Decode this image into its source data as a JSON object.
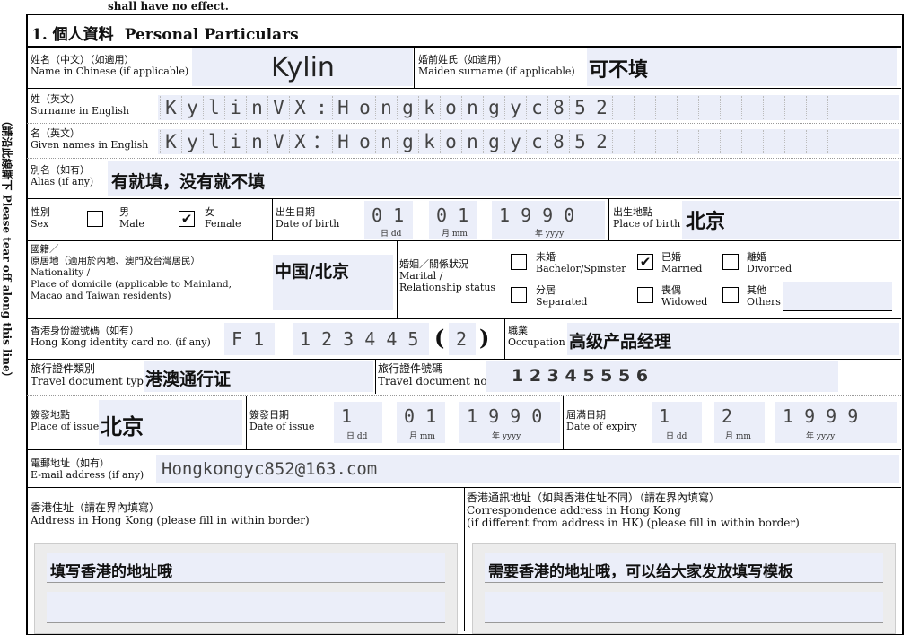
{
  "top_note": "shall have no effect.",
  "side_label": "（請沿此線撕下 Please tear off along this line）",
  "section": {
    "number": "1.",
    "title_zh": "個人資料",
    "title_en": "Personal Particulars"
  },
  "name_zh": {
    "label_zh": "姓名（中文）（如適用）",
    "label_en": "Name in Chinese (if applicable)",
    "value": "Kylin"
  },
  "maiden": {
    "label_zh": "婚前姓氏（如適用）",
    "label_en": "Maiden surname (if applicable)",
    "value": "可不填"
  },
  "surname": {
    "label_zh": "姓（英文）",
    "label_en": "Surname in English",
    "chars": [
      "K",
      "y",
      "l",
      "i",
      "n",
      "V",
      "X",
      ":",
      "H",
      "o",
      "n",
      "g",
      "k",
      "o",
      "n",
      "g",
      "y",
      "c",
      "8",
      "5",
      "2",
      "",
      "",
      "",
      "",
      "",
      "",
      "",
      "",
      "",
      "",
      ""
    ]
  },
  "given": {
    "label_zh": "名（英文）",
    "label_en": "Given names in English",
    "chars": [
      "K",
      "y",
      "l",
      "i",
      "n",
      "V",
      "X",
      "：",
      "H",
      "o",
      "n",
      "g",
      "k",
      "o",
      "n",
      "g",
      "y",
      "c",
      "8",
      "5",
      "2",
      "",
      "",
      "",
      "",
      "",
      "",
      "",
      "",
      "",
      "",
      ""
    ]
  },
  "alias": {
    "label_zh": "別名（如有）",
    "label_en": "Alias (if any)",
    "value": "有就填，没有就不填"
  },
  "sex": {
    "label_zh": "性別",
    "label_en": "Sex",
    "male_zh": "男",
    "male_en": "Male",
    "female_zh": "女",
    "female_en": "Female",
    "male_checked": "",
    "female_checked": "✔"
  },
  "dob": {
    "label_zh": "出生日期",
    "label_en": "Date of birth",
    "dd": "0 1",
    "mm": "0 1",
    "yyyy": "1 9 9 0",
    "dd_hint": "日 dd",
    "mm_hint": "月 mm",
    "yyyy_hint": "年 yyyy"
  },
  "pob": {
    "label_zh": "出生地點",
    "label_en": "Place of birth",
    "value": "北京"
  },
  "nationality": {
    "l1": "國籍／",
    "l2": "原居地（適用於內地、澳門及台灣居民）",
    "l3": "Nationality /",
    "l4": "Place of domicile (applicable to Mainland,",
    "l5": "Macao and Taiwan residents)",
    "value": "中国/北京"
  },
  "marital": {
    "label_zh": "婚姻／關係狀況",
    "label_en1": "Marital /",
    "label_en2": "Relationship status",
    "bachelor_zh": "未婚",
    "bachelor_en": "Bachelor/Spinster",
    "married_zh": "已婚",
    "married_en": "Married",
    "married_checked": "✔",
    "divorced_zh": "離婚",
    "divorced_en": "Divorced",
    "separated_zh": "分居",
    "separated_en": "Separated",
    "widowed_zh": "喪偶",
    "widowed_en": "Widowed",
    "others_zh": "其他",
    "others_en": "Others"
  },
  "hkid": {
    "label_zh": "香港身份證號碼（如有）",
    "label_en": "Hong Kong identity card no. (if any)",
    "prefix": "F 1",
    "digits": "1 2 3 4 4 5",
    "open": "(",
    "check": "2",
    "close": ")"
  },
  "occupation": {
    "label_zh": "職業",
    "label_en": "Occupation",
    "value": "高级产品经理"
  },
  "travel_type": {
    "label_zh": "旅行證件類別",
    "label_en": "Travel document type",
    "value": "港澳通行证"
  },
  "travel_no": {
    "label_zh": "旅行證件號碼",
    "label_en": "Travel document no.",
    "value": "1 2 3 4 5 5 5 6"
  },
  "issue_place": {
    "label_zh": "簽發地點",
    "label_en": "Place of issue",
    "value": "北京"
  },
  "issue_date": {
    "label_zh": "簽發日期",
    "label_en": "Date of issue",
    "dd": "1",
    "mm": "0 1",
    "yyyy": "1 9 9 0",
    "dd_hint": "日 dd",
    "mm_hint": "月 mm",
    "yyyy_hint": "年 yyyy"
  },
  "expiry": {
    "label_zh": "屆滿日期",
    "label_en": "Date of expiry",
    "dd": "1",
    "mm": "2",
    "yyyy": "1 9 9 9",
    "dd_hint": "日 dd",
    "mm_hint": "月 mm",
    "yyyy_hint": "年 yyyy"
  },
  "email": {
    "label_zh": "電郵地址（如有）",
    "label_en": "E-mail address (if any)",
    "value": "Hongkongyc852@163.com"
  },
  "hk_addr": {
    "label_zh": "香港住址（請在界內填寫）",
    "label_en": "Address in Hong Kong (please fill in within border)",
    "value": "填写香港的地址哦"
  },
  "corr_addr": {
    "label_zh": "香港通訊地址（如與香港住址不同）（請在界內填寫）",
    "label_en1": "Correspondence address in Hong Kong",
    "label_en2": "(if different from address in HK) (please fill in within border)",
    "value": "需要香港的地址哦，可以给大家发放填写模板"
  }
}
